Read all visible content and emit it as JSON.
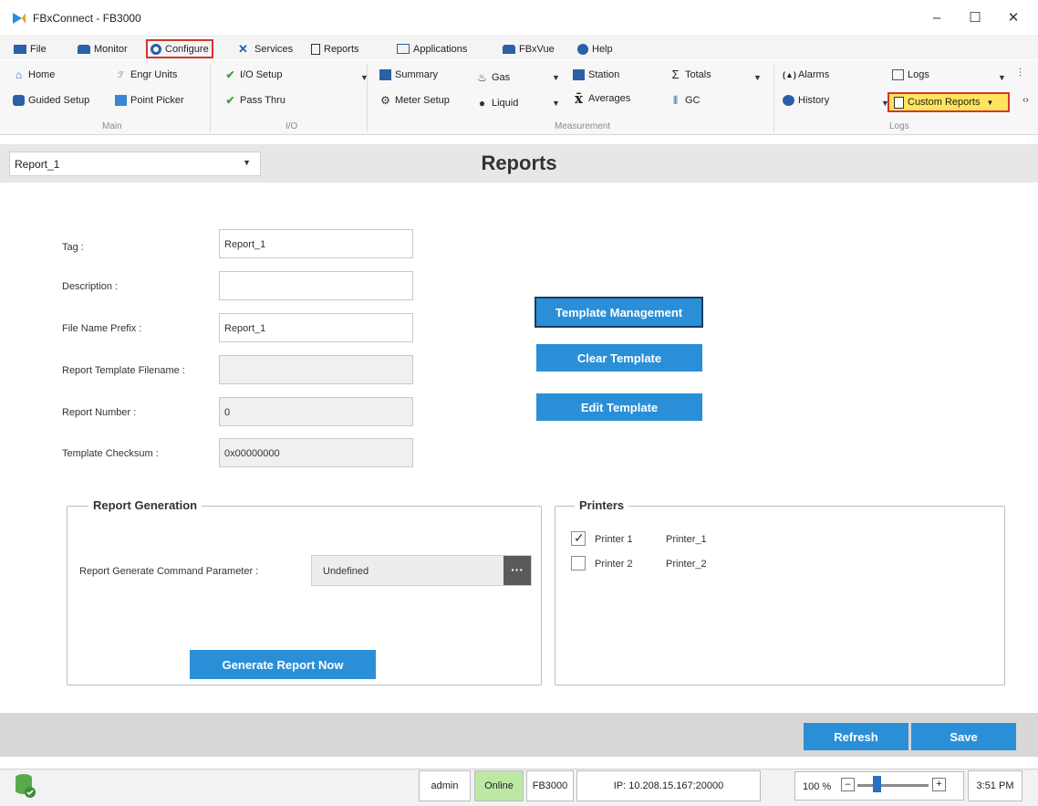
{
  "window": {
    "title": "FBxConnect - FB3000",
    "minimize": "–",
    "maximize": "☐",
    "close": "✕"
  },
  "menu": {
    "items": [
      {
        "label": "File",
        "icon": "file-icon"
      },
      {
        "label": "Monitor",
        "icon": "monitor-icon"
      },
      {
        "label": "Configure",
        "icon": "configure-icon"
      },
      {
        "label": "Services",
        "icon": "services-icon"
      },
      {
        "label": "Reports",
        "icon": "reports-icon"
      },
      {
        "label": "Applications",
        "icon": "applications-icon"
      },
      {
        "label": "FBxVue",
        "icon": "fbxvue-icon"
      },
      {
        "label": "Help",
        "icon": "help-icon"
      }
    ]
  },
  "ribbon": {
    "home": "Home",
    "engr_units": "Engr Units",
    "guided_setup": "Guided Setup",
    "point_picker": "Point Picker",
    "main_label": "Main",
    "io_setup": "I/O Setup",
    "pass_thru": "Pass Thru",
    "io_label": "I/O",
    "summary": "Summary",
    "meter_setup": "Meter Setup",
    "gas": "Gas",
    "liquid": "Liquid",
    "station": "Station",
    "averages": "Averages",
    "totals": "Totals",
    "gc": "GC",
    "measurement_label": "Measurement",
    "alarms": "Alarms",
    "history": "History",
    "logs": "Logs",
    "custom_reports": "Custom Reports",
    "logs_label": "Logs"
  },
  "report_select": {
    "value": "Report_1"
  },
  "page": {
    "title": "Reports"
  },
  "form": {
    "tag_label": "Tag :",
    "tag_value": "Report_1",
    "description_label": "Description :",
    "description_value": "",
    "file_prefix_label": "File Name Prefix :",
    "file_prefix_value": "Report_1",
    "template_filename_label": "Report Template Filename :",
    "template_filename_value": "",
    "report_number_label": "Report Number :",
    "report_number_value": "0",
    "checksum_label": "Template Checksum :",
    "checksum_value": "0x00000000"
  },
  "template_buttons": {
    "management": "Template Management",
    "clear": "Clear Template",
    "edit": "Edit Template"
  },
  "report_generation": {
    "title": "Report Generation",
    "param_label": "Report Generate Command Parameter :",
    "param_value": "Undefined",
    "browse": "···",
    "generate_button": "Generate Report Now"
  },
  "printers": {
    "title": "Printers",
    "items": [
      {
        "label": "Printer 1",
        "name": "Printer_1",
        "checked": true
      },
      {
        "label": "Printer 2",
        "name": "Printer_2",
        "checked": false
      }
    ]
  },
  "actions": {
    "refresh": "Refresh",
    "save": "Save"
  },
  "status": {
    "user": "admin",
    "connection": "Online",
    "device": "FB3000",
    "ip": "IP: 10.208.15.167:20000",
    "zoom": "100 %",
    "zoom_minus": "–",
    "zoom_plus": "+",
    "zoom_level": 0.5,
    "time": "3:51 PM"
  },
  "colors": {
    "accent_blue": "#2a8fd7",
    "highlight_red": "#d9342b",
    "highlight_yellow": "#ffe45c",
    "online_green": "#bde8a3"
  }
}
